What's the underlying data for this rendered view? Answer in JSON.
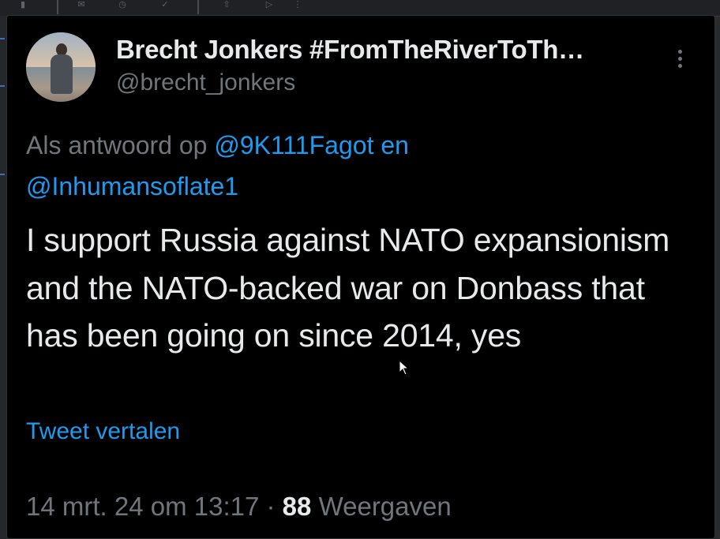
{
  "tweet": {
    "display_name": "Brecht Jonkers #FromTheRiverToTh…",
    "handle": "@brecht_jonkers",
    "reply_prefix": "Als antwoord op",
    "reply_mention_1": "@9K111Fagot",
    "reply_joiner": "en",
    "reply_mention_2": "@Inhumansoflate1",
    "text": "I support Russia against NATO expansionism and the NATO-backed war on Donbass that has been going on since 2014, yes",
    "translate_label": "Tweet vertalen",
    "date": "14 mrt. 24 om 13:17",
    "separator": "·",
    "view_count": "88",
    "view_label": "Weergaven"
  },
  "colors": {
    "background": "#000000",
    "primary_text": "#e7e9ea",
    "secondary_text": "#71767b",
    "link": "#1d9bf0"
  },
  "icons": {
    "more": "more-vertical-icon",
    "cursor": "mouse-pointer-icon"
  }
}
